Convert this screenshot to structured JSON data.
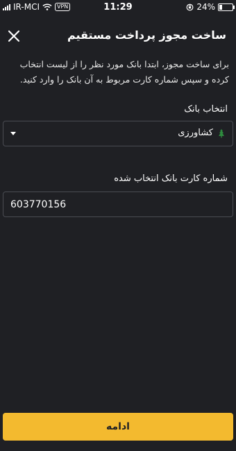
{
  "status_bar": {
    "carrier": "IR-MCI",
    "vpn": "VPN",
    "time": "11:29",
    "battery": "24%",
    "battery_level": 0.24
  },
  "header": {
    "title": "ساخت مجوز پرداخت مستقیم",
    "close_icon": "close-icon"
  },
  "description": "برای ساخت مجوز، ابتدا بانک مورد نظر را از لیست انتخاب کرده و سپس شماره کارت مربوط به آن بانک را وارد کنید.",
  "bank_select": {
    "label": "انتخاب بانک",
    "selected": "کشاورزی",
    "logo_icon": "keshavarzi-bank-logo-icon",
    "logo_color": "#2e8b3e"
  },
  "card_input": {
    "label": "شماره کارت بانک انتخاب شده",
    "value": "603770156"
  },
  "continue_button": {
    "label": "ادامه",
    "color": "#f3ba2f"
  }
}
